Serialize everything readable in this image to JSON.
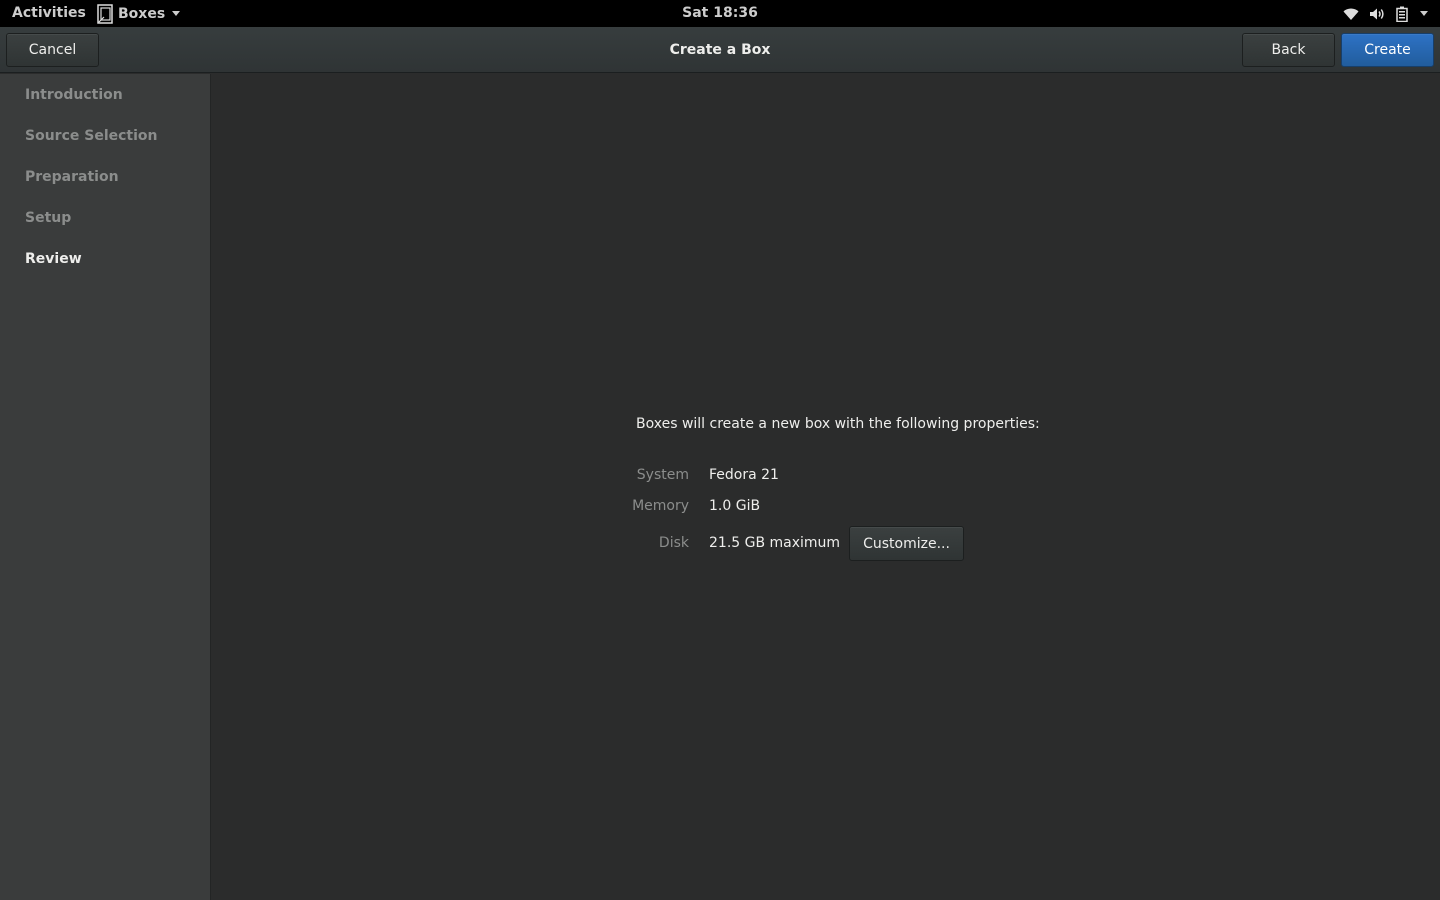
{
  "topbar": {
    "activities": "Activities",
    "app_name": "Boxes",
    "clock": "Sat 18:36"
  },
  "headerbar": {
    "title": "Create a Box",
    "cancel_label": "Cancel",
    "back_label": "Back",
    "create_label": "Create"
  },
  "sidebar": {
    "items": [
      {
        "label": "Introduction",
        "active": false
      },
      {
        "label": "Source Selection",
        "active": false
      },
      {
        "label": "Preparation",
        "active": false
      },
      {
        "label": "Setup",
        "active": false
      },
      {
        "label": "Review",
        "active": true
      }
    ]
  },
  "review": {
    "intro": "Boxes will create a new box with the following properties:",
    "properties": [
      {
        "label": "System",
        "value": "Fedora 21"
      },
      {
        "label": "Memory",
        "value": "1.0 GiB"
      },
      {
        "label": "Disk",
        "value": "21.5 GB maximum"
      }
    ],
    "customize_label": "Customize..."
  },
  "colors": {
    "accent": "#2a6bbd",
    "topbar_bg": "#000000",
    "sidebar_bg": "#3a3c3c",
    "main_bg": "#2b2c2c"
  },
  "icons": {
    "app": "boxes-app-icon",
    "wifi": "wifi-icon",
    "volume": "volume-icon",
    "battery": "battery-icon",
    "menu": "chevron-down-icon"
  }
}
